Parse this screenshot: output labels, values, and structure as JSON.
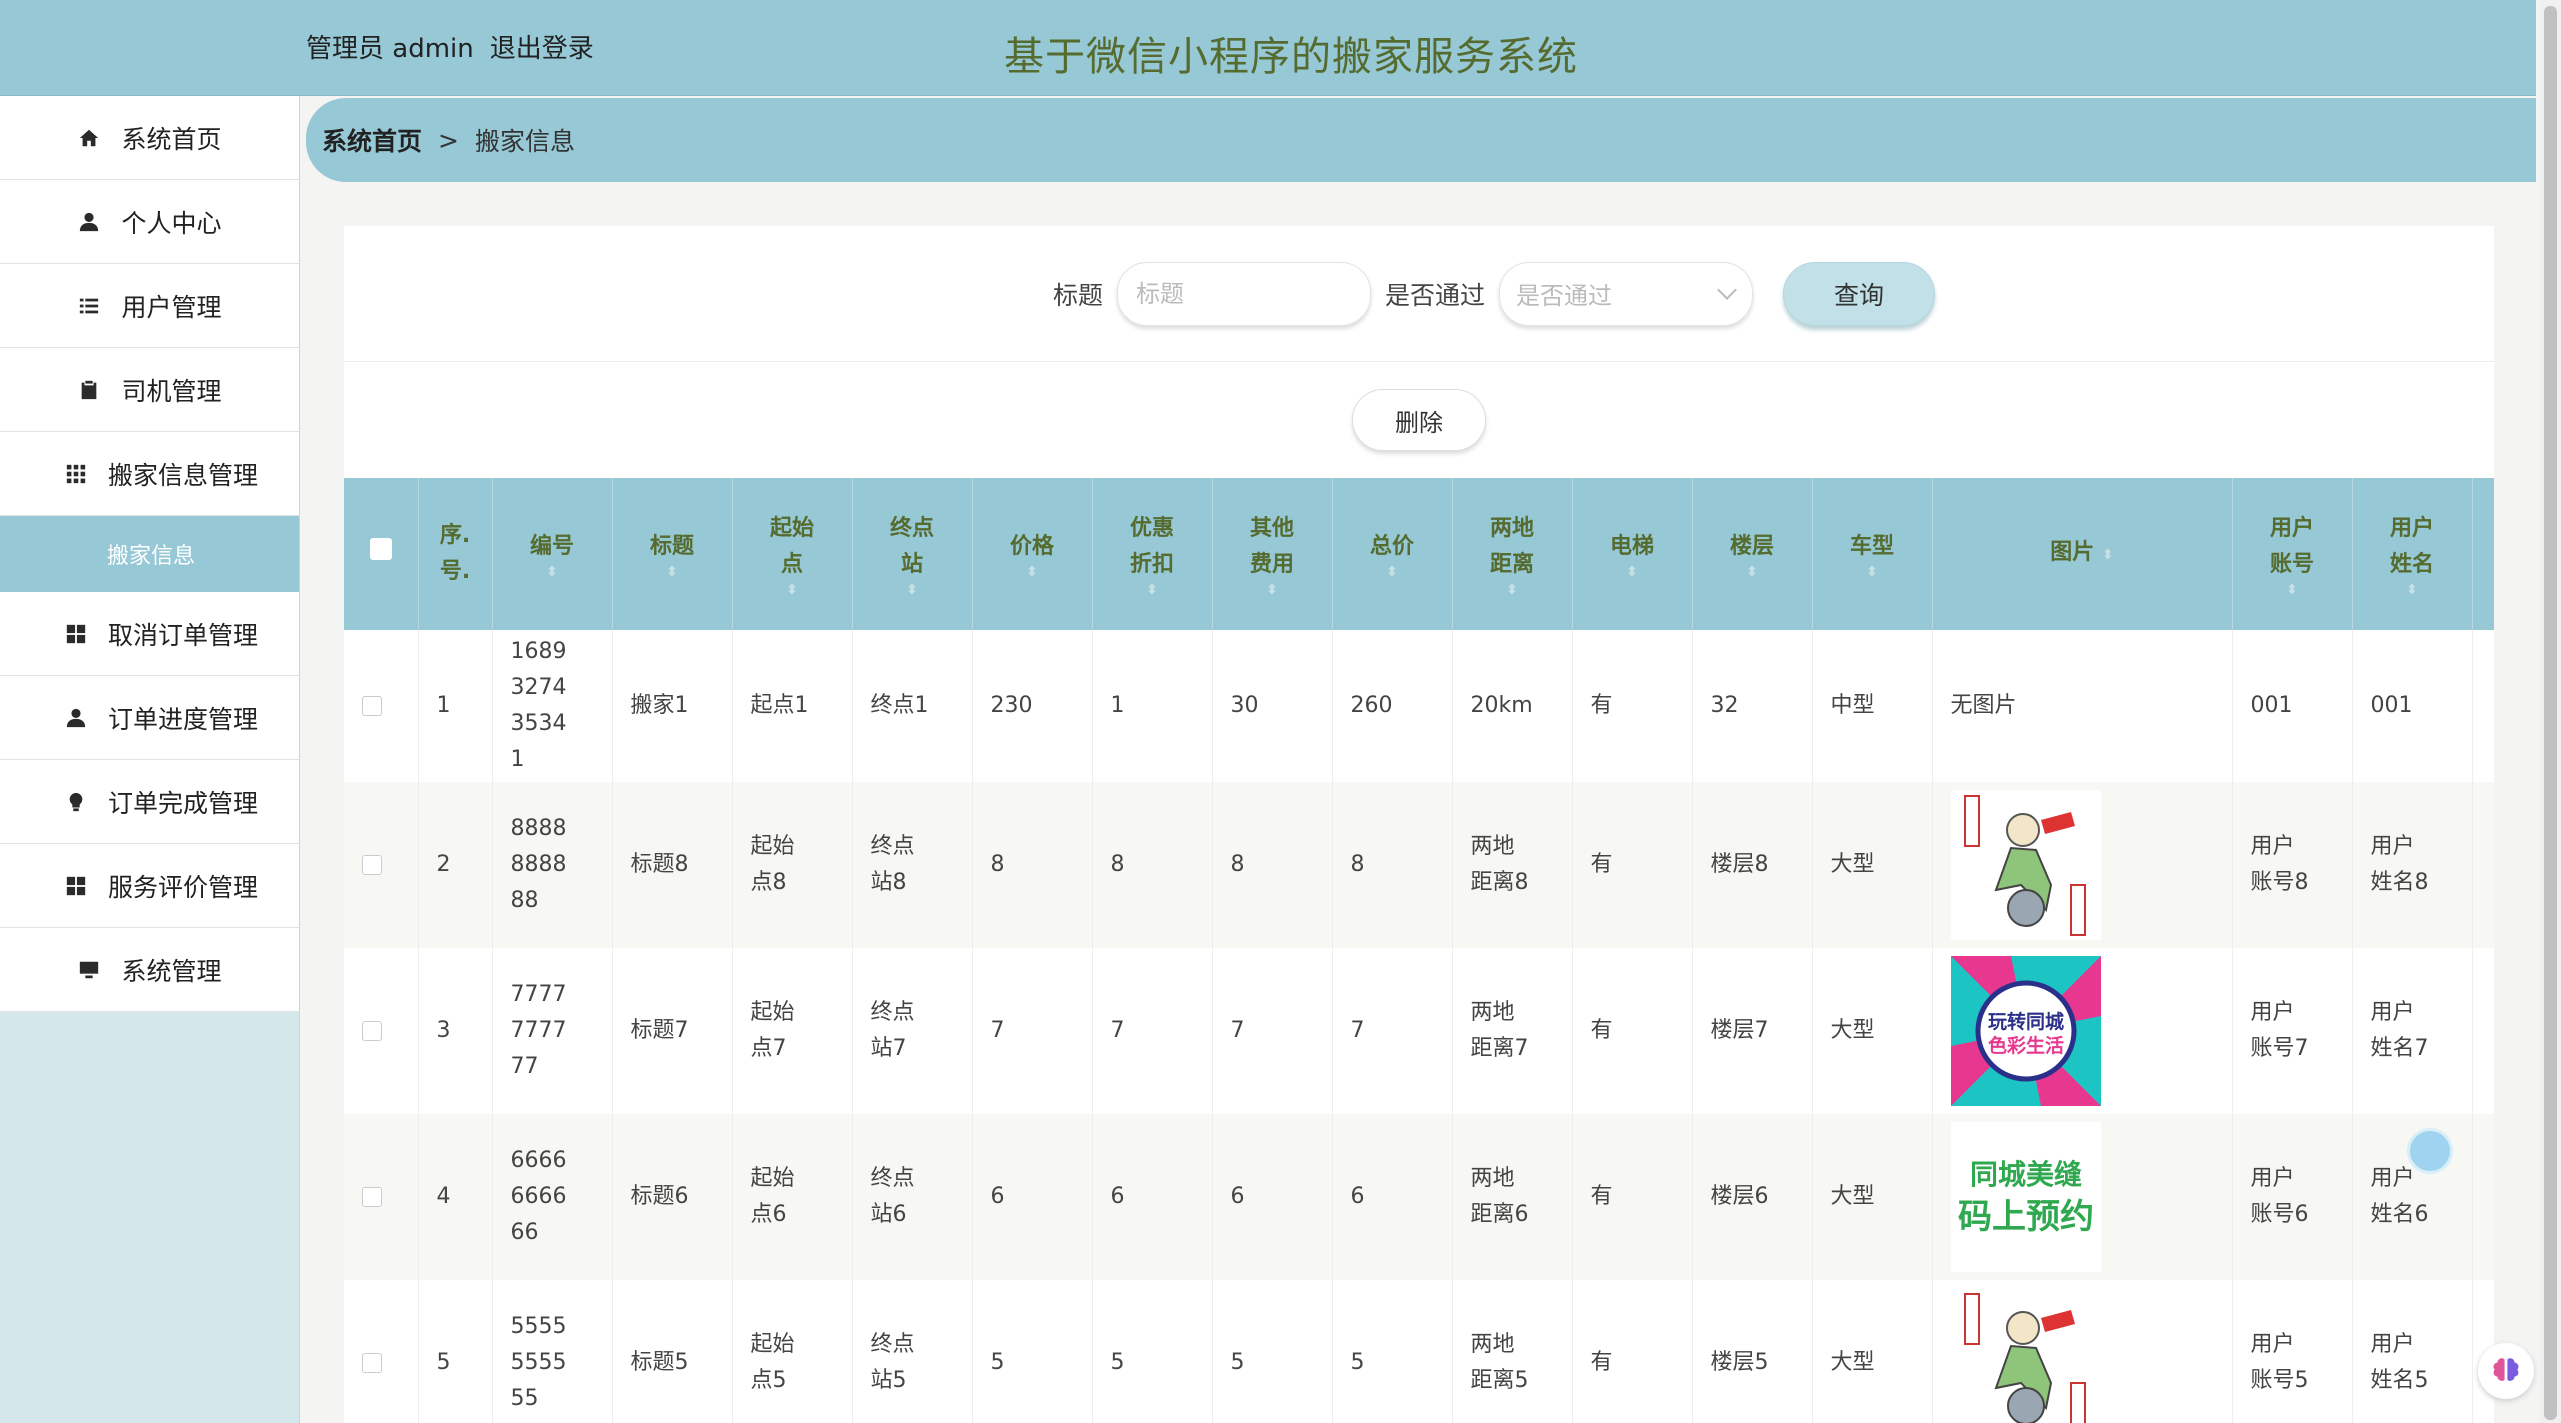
{
  "header": {
    "admin_label": "管理员 admin",
    "logout_label": "退出登录",
    "system_title": "基于微信小程序的搬家服务系统"
  },
  "sidebar": {
    "items": [
      {
        "label": "系统首页",
        "icon": "home-icon"
      },
      {
        "label": "个人中心",
        "icon": "user-icon"
      },
      {
        "label": "用户管理",
        "icon": "list-icon"
      },
      {
        "label": "司机管理",
        "icon": "clipboard-icon"
      },
      {
        "label": "搬家信息管理",
        "icon": "grid-icon"
      },
      {
        "label": "取消订单管理",
        "icon": "grid-icon"
      },
      {
        "label": "订单进度管理",
        "icon": "user-icon"
      },
      {
        "label": "订单完成管理",
        "icon": "bulb-icon"
      },
      {
        "label": "服务评价管理",
        "icon": "grid-icon"
      },
      {
        "label": "系统管理",
        "icon": "monitor-icon"
      }
    ],
    "active_sub": "搬家信息"
  },
  "breadcrumb": {
    "home": "系统首页",
    "separator": ">",
    "current": "搬家信息"
  },
  "search": {
    "title_label": "标题",
    "title_placeholder": "标题",
    "pass_label": "是否通过",
    "pass_placeholder": "是否通过",
    "query_button": "查询"
  },
  "actions": {
    "delete_button": "删除"
  },
  "table": {
    "headers": {
      "index": "序.\n号.",
      "code": "编号",
      "title": "标题",
      "start": "起始\n点",
      "end": "终点\n站",
      "price": "价格",
      "discount": "优惠\n折扣",
      "other_fee": "其他\n费用",
      "total": "总价",
      "distance": "两地\n距离",
      "elevator": "电梯",
      "floor": "楼层",
      "car_type": "车型",
      "image": "图片",
      "user_account": "用户\n账号",
      "user_name": "用户\n姓名"
    },
    "rows": [
      {
        "index": "1",
        "code": "1689\n3274\n3534\n1",
        "title": "搬家1",
        "start": "起点1",
        "end": "终点1",
        "price": "230",
        "discount": "1",
        "other_fee": "30",
        "total": "260",
        "distance": "20km",
        "elevator": "有",
        "floor": "32",
        "car_type": "中型",
        "image": "无图片",
        "image_kind": "none",
        "user_account": "001",
        "user_name": "001"
      },
      {
        "index": "2",
        "code": "8888\n8888\n88",
        "title": "标题8",
        "start": "起始\n点8",
        "end": "终点\n站8",
        "price": "8",
        "discount": "8",
        "other_fee": "8",
        "total": "8",
        "distance": "两地\n距离8",
        "elevator": "有",
        "floor": "楼层8",
        "car_type": "大型",
        "image": "",
        "image_kind": "poster-runner",
        "user_account": "用户\n账号8",
        "user_name": "用户\n姓名8"
      },
      {
        "index": "3",
        "code": "7777\n7777\n77",
        "title": "标题7",
        "start": "起始\n点7",
        "end": "终点\n站7",
        "price": "7",
        "discount": "7",
        "other_fee": "7",
        "total": "7",
        "distance": "两地\n距离7",
        "elevator": "有",
        "floor": "楼层7",
        "car_type": "大型",
        "image": "",
        "image_kind": "poster-color",
        "image_text": [
          "玩转同城",
          "色彩生活"
        ],
        "user_account": "用户\n账号7",
        "user_name": "用户\n姓名7"
      },
      {
        "index": "4",
        "code": "6666\n6666\n66",
        "title": "标题6",
        "start": "起始\n点6",
        "end": "终点\n站6",
        "price": "6",
        "discount": "6",
        "other_fee": "6",
        "total": "6",
        "distance": "两地\n距离6",
        "elevator": "有",
        "floor": "楼层6",
        "car_type": "大型",
        "image": "",
        "image_kind": "poster-green",
        "image_text": [
          "同城美缝",
          "码上预约"
        ],
        "user_account": "用户\n账号6",
        "user_name": "用户\n姓名6"
      },
      {
        "index": "5",
        "code": "5555\n5555\n55",
        "title": "标题5",
        "start": "起始\n点5",
        "end": "终点\n站5",
        "price": "5",
        "discount": "5",
        "other_fee": "5",
        "total": "5",
        "distance": "两地\n距离5",
        "elevator": "有",
        "floor": "楼层5",
        "car_type": "大型",
        "image": "",
        "image_kind": "poster-runner",
        "user_account": "用户\n账号5",
        "user_name": "用户\n姓名5"
      }
    ]
  },
  "colors": {
    "accent": "#97c8d5",
    "header_text": "#556b2f",
    "sidebar_bg": "#d4e7ea"
  }
}
